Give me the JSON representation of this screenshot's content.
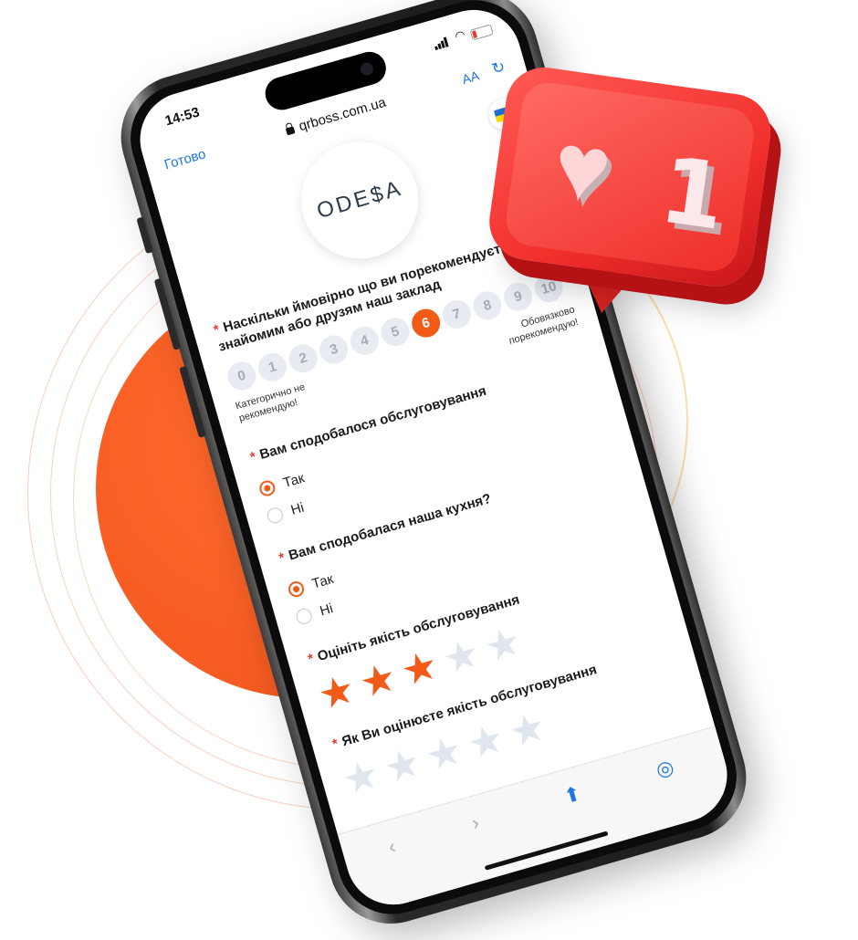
{
  "status_bar": {
    "time": "14:53"
  },
  "browser": {
    "done_label": "Готово",
    "url": "qrboss.com.ua",
    "text_size_label": "AA",
    "reload_icon": "reload-icon"
  },
  "language_flag": "ukraine-flag-icon",
  "logo": {
    "text": "ODE$A"
  },
  "form": {
    "q1": {
      "required_mark": "*",
      "text": "Наскільки ймовірно що ви пореко... знайомим або друзям наш заклад",
      "text_visible": "Наскільки ймовірно що ви порекомендуєте знайомим або друзям наш заклад",
      "scale": [
        "0",
        "1",
        "2",
        "3",
        "4",
        "5",
        "6",
        "7",
        "8",
        "9",
        "10"
      ],
      "selected": 6,
      "left_label": "Категорично не рекомендую!",
      "right_label": "Обовязково порекомендую!"
    },
    "q2": {
      "required_mark": "*",
      "text": "Вам сподобалося обслуговування",
      "options": [
        "Так",
        "Ні"
      ],
      "selected": "Так"
    },
    "q3": {
      "required_mark": "*",
      "text": "Вам сподобалася наша кухня?",
      "options": [
        "Так",
        "Ні"
      ],
      "selected": "Так"
    },
    "q4": {
      "required_mark": "*",
      "text": "Оцініть якість обслуговування",
      "rating": 3,
      "max": 5
    },
    "q5": {
      "required_mark": "*",
      "text": "Як Ви оцінюєте якість обслуговування",
      "rating": 0,
      "max": 5
    }
  },
  "toolbar": {
    "back_icon": "chevron-left-icon",
    "forward_icon": "chevron-right-icon",
    "share_icon": "share-icon",
    "compass_icon": "compass-icon"
  },
  "notification": {
    "icon": "heart-icon",
    "count": "1"
  },
  "colors": {
    "accent": "#f25a17",
    "link": "#1e76e0",
    "like_red": "#f2302c"
  }
}
